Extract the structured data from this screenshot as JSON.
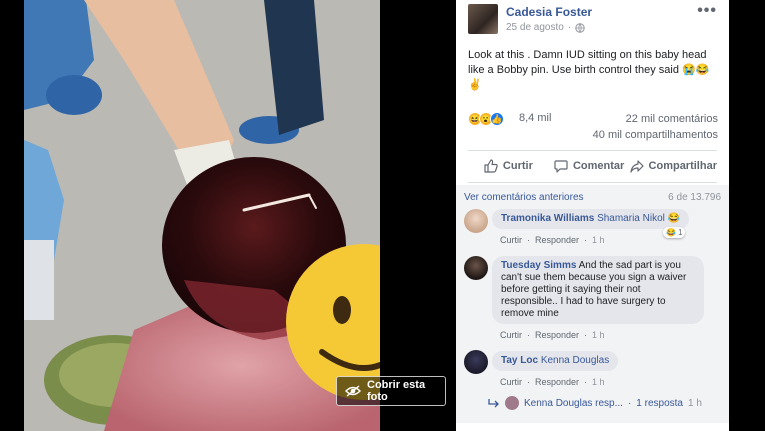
{
  "photo": {
    "cover_button_label": "Cobrir esta foto",
    "eye_icon": "eye-slash-icon"
  },
  "post": {
    "author": "Cadesia Foster",
    "date": "25 de agosto",
    "audience_icon": "globe-icon",
    "more_icon": "more-dots-icon",
    "more_label": "•••",
    "text": "Look at this . Damn IUD sitting on this baby head like a Bobby pin. Use birth control they said 😭😂✌",
    "reactions": {
      "icons": [
        "haha",
        "wow",
        "like"
      ],
      "count": "8,4 mil",
      "comments": "22 mil comentários",
      "shares": "40 mil compartilhamentos"
    },
    "actions": {
      "like": "Curtir",
      "comment": "Comentar",
      "share": "Compartilhar"
    }
  },
  "comments": {
    "previous_link": "Ver comentários anteriores",
    "range": "6 de 13.796",
    "items": [
      {
        "name": "Tramonika Williams",
        "tag": "Shamaria Nikol",
        "text": "😂",
        "actions": [
          "Curtir",
          "Responder"
        ],
        "time": "1 h",
        "reaction_badge": "😂",
        "reaction_count": "1"
      },
      {
        "name": "Tuesday Simms",
        "text": "And the sad part is you can't sue them because you sign a waiver before getting it saying their not responsible.. I had to have surgery to remove mine",
        "actions": [
          "Curtir",
          "Responder"
        ],
        "time": "1 h"
      },
      {
        "name": "Tay Loc",
        "tag": "Kenna Douglas",
        "text": "",
        "actions": [
          "Curtir",
          "Responder"
        ],
        "time": "1 h"
      }
    ],
    "reply": {
      "author_short": "Kenna Douglas resp...",
      "link": "1 resposta",
      "time": "1 h"
    }
  },
  "colors": {
    "link": "#385898",
    "bubble": "#e4e6eb",
    "comments_bg": "#f2f3f5"
  }
}
